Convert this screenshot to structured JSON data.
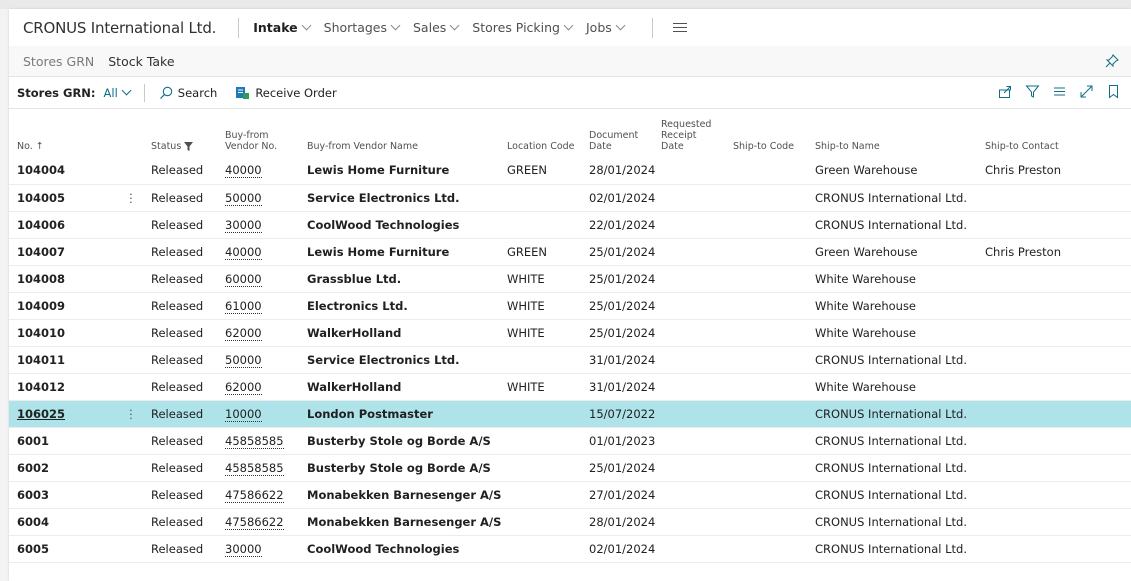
{
  "app": {
    "company": "CRONUS International Ltd.",
    "nav": [
      {
        "label": "Intake",
        "active": true
      },
      {
        "label": "Shortages",
        "active": false
      },
      {
        "label": "Sales",
        "active": false
      },
      {
        "label": "Stores Picking",
        "active": false
      },
      {
        "label": "Jobs",
        "active": false
      }
    ]
  },
  "subnav": {
    "items": [
      "Stores GRN",
      "Stock Take"
    ]
  },
  "actionbar": {
    "filter_label": "Stores GRN:",
    "filter_value": "All",
    "search_label": "Search",
    "receive_label": "Receive Order"
  },
  "table": {
    "headers": {
      "no": "No. ↑",
      "status": "Status",
      "vendor_no_1": "Buy-from",
      "vendor_no_2": "Vendor No.",
      "vendor_name": "Buy-from Vendor Name",
      "location": "Location Code",
      "doc_date_1": "Document",
      "doc_date_2": "Date",
      "req_date_1": "Requested",
      "req_date_2": "Receipt Date",
      "ship_code": "Ship-to Code",
      "ship_name": "Ship-to Name",
      "ship_contact": "Ship-to Contact"
    },
    "rows": [
      {
        "no": "104004",
        "status": "Released",
        "vendor_no": "40000",
        "vendor_name": "Lewis Home Furniture",
        "location": "GREEN",
        "doc_date": "28/01/2024",
        "req_date": "",
        "ship_code": "",
        "ship_name": "Green Warehouse",
        "ship_contact": "Chris Preston"
      },
      {
        "no": "104005",
        "status": "Released",
        "vendor_no": "50000",
        "vendor_name": "Service Electronics Ltd.",
        "location": "",
        "doc_date": "02/01/2024",
        "req_date": "",
        "ship_code": "",
        "ship_name": "CRONUS International Ltd.",
        "ship_contact": ""
      },
      {
        "no": "104006",
        "status": "Released",
        "vendor_no": "30000",
        "vendor_name": "CoolWood Technologies",
        "location": "",
        "doc_date": "22/01/2024",
        "req_date": "",
        "ship_code": "",
        "ship_name": "CRONUS International Ltd.",
        "ship_contact": ""
      },
      {
        "no": "104007",
        "status": "Released",
        "vendor_no": "40000",
        "vendor_name": "Lewis Home Furniture",
        "location": "GREEN",
        "doc_date": "25/01/2024",
        "req_date": "",
        "ship_code": "",
        "ship_name": "Green Warehouse",
        "ship_contact": "Chris Preston"
      },
      {
        "no": "104008",
        "status": "Released",
        "vendor_no": "60000",
        "vendor_name": "Grassblue Ltd.",
        "location": "WHITE",
        "doc_date": "25/01/2024",
        "req_date": "",
        "ship_code": "",
        "ship_name": "White Warehouse",
        "ship_contact": ""
      },
      {
        "no": "104009",
        "status": "Released",
        "vendor_no": "61000",
        "vendor_name": "Electronics Ltd.",
        "location": "WHITE",
        "doc_date": "25/01/2024",
        "req_date": "",
        "ship_code": "",
        "ship_name": "White Warehouse",
        "ship_contact": ""
      },
      {
        "no": "104010",
        "status": "Released",
        "vendor_no": "62000",
        "vendor_name": "WalkerHolland",
        "location": "WHITE",
        "doc_date": "25/01/2024",
        "req_date": "",
        "ship_code": "",
        "ship_name": "White Warehouse",
        "ship_contact": ""
      },
      {
        "no": "104011",
        "status": "Released",
        "vendor_no": "50000",
        "vendor_name": "Service Electronics Ltd.",
        "location": "",
        "doc_date": "31/01/2024",
        "req_date": "",
        "ship_code": "",
        "ship_name": "CRONUS International Ltd.",
        "ship_contact": ""
      },
      {
        "no": "104012",
        "status": "Released",
        "vendor_no": "62000",
        "vendor_name": "WalkerHolland",
        "location": "WHITE",
        "doc_date": "31/01/2024",
        "req_date": "",
        "ship_code": "",
        "ship_name": "White Warehouse",
        "ship_contact": ""
      },
      {
        "no": "106025",
        "status": "Released",
        "vendor_no": "10000",
        "vendor_name": "London Postmaster",
        "location": "",
        "doc_date": "15/07/2022",
        "req_date": "",
        "ship_code": "",
        "ship_name": "CRONUS International Ltd.",
        "ship_contact": ""
      },
      {
        "no": "6001",
        "status": "Released",
        "vendor_no": "45858585",
        "vendor_name": "Busterby Stole og Borde A/S",
        "location": "",
        "doc_date": "01/01/2023",
        "req_date": "",
        "ship_code": "",
        "ship_name": "CRONUS International Ltd.",
        "ship_contact": ""
      },
      {
        "no": "6002",
        "status": "Released",
        "vendor_no": "45858585",
        "vendor_name": "Busterby Stole og Borde A/S",
        "location": "",
        "doc_date": "25/01/2024",
        "req_date": "",
        "ship_code": "",
        "ship_name": "CRONUS International Ltd.",
        "ship_contact": ""
      },
      {
        "no": "6003",
        "status": "Released",
        "vendor_no": "47586622",
        "vendor_name": "Monabekken Barnesenger A/S",
        "location": "",
        "doc_date": "27/01/2024",
        "req_date": "",
        "ship_code": "",
        "ship_name": "CRONUS International Ltd.",
        "ship_contact": ""
      },
      {
        "no": "6004",
        "status": "Released",
        "vendor_no": "47586622",
        "vendor_name": "Monabekken Barnesenger A/S",
        "location": "",
        "doc_date": "28/01/2024",
        "req_date": "",
        "ship_code": "",
        "ship_name": "CRONUS International Ltd.",
        "ship_contact": ""
      },
      {
        "no": "6005",
        "status": "Released",
        "vendor_no": "30000",
        "vendor_name": "CoolWood Technologies",
        "location": "",
        "doc_date": "02/01/2024",
        "req_date": "",
        "ship_code": "",
        "ship_name": "CRONUS International Ltd.",
        "ship_contact": ""
      }
    ],
    "hovered_row_index": 1,
    "selected_row_index": 9
  },
  "colors": {
    "accent": "#0f6e89",
    "selected_row": "#aee3e9",
    "receive_icon": "#1e7bb8"
  },
  "icons": [
    "chevron-down-icon",
    "hamburger-menu-icon",
    "pin-icon",
    "search-icon",
    "receive-order-icon",
    "share-icon",
    "filter-icon",
    "list-view-icon",
    "expand-icon",
    "bookmark-icon",
    "sort-ascending-icon",
    "column-filter-icon",
    "row-actions-icon"
  ]
}
